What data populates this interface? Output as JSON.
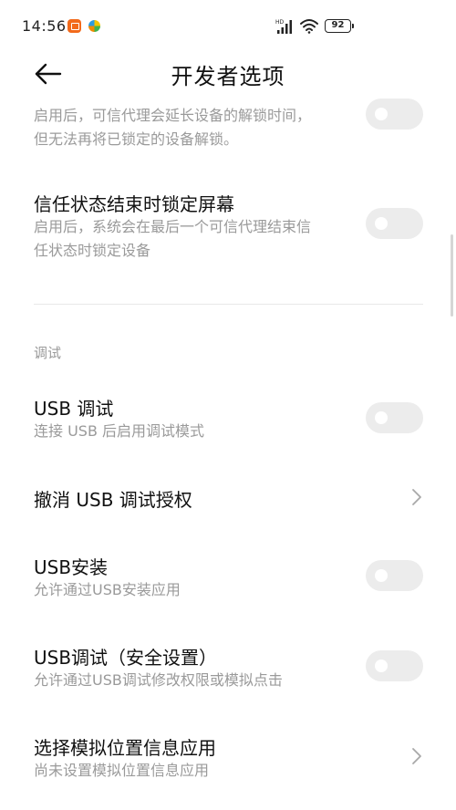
{
  "status_bar": {
    "time": "14:56",
    "battery": "92",
    "network_label": "HD"
  },
  "header": {
    "title": "开发者选项"
  },
  "rows": {
    "trust_unlock": {
      "subtitle_line1": "启用后，可信代理会延长设备的解锁时间，",
      "subtitle_line2": "但无法再将已锁定的设备解锁。",
      "toggle_on": false
    },
    "trust_lock": {
      "title": "信任状态结束时锁定屏幕",
      "subtitle_line1": "启用后，系统会在最后一个可信代理结束信",
      "subtitle_line2": "任状态时锁定设备",
      "toggle_on": false
    },
    "section": {
      "label": "调试"
    },
    "usb_debug": {
      "title": "USB 调试",
      "subtitle": "连接 USB 后启用调试模式",
      "toggle_on": false
    },
    "revoke_usb": {
      "title": "撤消 USB 调试授权"
    },
    "usb_install": {
      "title": "USB安装",
      "subtitle": "允许通过USB安装应用",
      "toggle_on": false
    },
    "usb_debug_secure": {
      "title": "USB调试（安全设置）",
      "subtitle": "允许通过USB调试修改权限或模拟点击",
      "toggle_on": false
    },
    "mock_location": {
      "title": "选择模拟位置信息应用",
      "subtitle": "尚未设置模拟位置信息应用"
    }
  },
  "colors": {
    "toggle_off": "#ececec",
    "subtitle": "#9a9a9a",
    "title": "#111111"
  }
}
